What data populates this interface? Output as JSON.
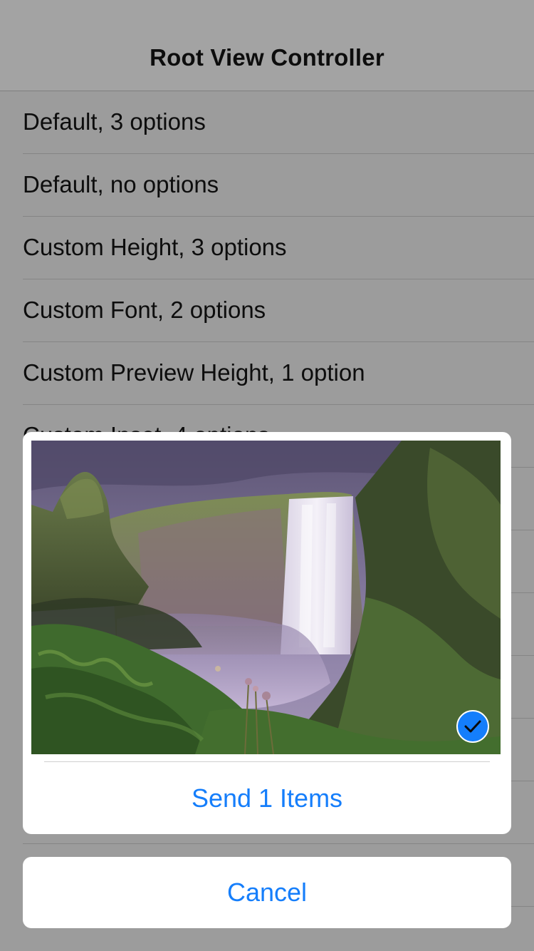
{
  "nav": {
    "title": "Root View Controller"
  },
  "table": {
    "rows": [
      {
        "label": "Default, 3 options"
      },
      {
        "label": "Default, no options"
      },
      {
        "label": "Custom Height, 3 options"
      },
      {
        "label": "Custom Font, 2 options"
      },
      {
        "label": "Custom Preview Height, 1 option"
      },
      {
        "label": "Custom Inset, 4 options"
      },
      {
        "label": ""
      },
      {
        "label": ""
      },
      {
        "label": ""
      },
      {
        "label": ""
      },
      {
        "label": ""
      },
      {
        "label": ""
      },
      {
        "label": ""
      }
    ]
  },
  "action_sheet": {
    "preview": {
      "icon": "waterfall-landscape-photo",
      "selected": true,
      "selection_icon": "checkmark-circle-icon"
    },
    "send_label": "Send 1 Items",
    "cancel_label": "Cancel"
  },
  "colors": {
    "accent": "#157efb",
    "dim_background": "#9c9c9c",
    "sheet_background": "#ffffff"
  }
}
